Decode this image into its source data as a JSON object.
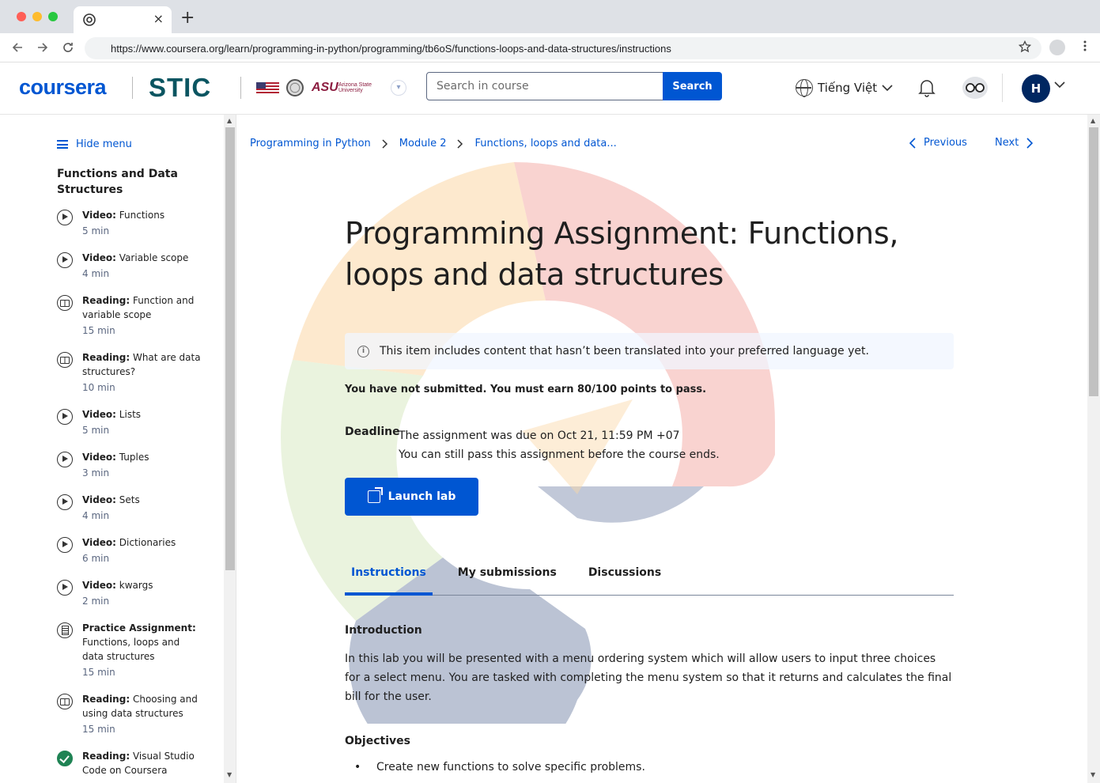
{
  "browser": {
    "tab_close": "×",
    "new_tab": "+",
    "url": "https://www.coursera.org/learn/programming-in-python/programming/tb6oS/functions-loops-and-data-structures/instructions",
    "back_icon": "arrow-left-icon",
    "forward_icon": "arrow-right-icon",
    "reload_icon": "reload-icon"
  },
  "header": {
    "logo_coursera": "coursera",
    "logo_stic": "STIC",
    "asu_logo": "ASU",
    "asu_sub": "Arizona State University",
    "search_placeholder": "Search in course",
    "search_button": "Search",
    "language": "Tiếng Việt",
    "avatar_initial": "H",
    "colors": {
      "brand": "#0056d2",
      "stic": "#0b5561",
      "avatar": "#002761"
    }
  },
  "sidebar": {
    "hide_menu": "Hide menu",
    "title": "Functions and Data Structures",
    "items": [
      {
        "type": "Video:",
        "name": "Functions",
        "duration": "5 min",
        "icon": "play"
      },
      {
        "type": "Video:",
        "name": "Variable scope",
        "duration": "4 min",
        "icon": "play"
      },
      {
        "type": "Reading:",
        "name": "Function and variable scope",
        "duration": "15 min",
        "icon": "book"
      },
      {
        "type": "Reading:",
        "name": "What are data structures?",
        "duration": "10 min",
        "icon": "book"
      },
      {
        "type": "Video:",
        "name": "Lists",
        "duration": "5 min",
        "icon": "play"
      },
      {
        "type": "Video:",
        "name": "Tuples",
        "duration": "3 min",
        "icon": "play"
      },
      {
        "type": "Video:",
        "name": "Sets",
        "duration": "4 min",
        "icon": "play"
      },
      {
        "type": "Video:",
        "name": "Dictionaries",
        "duration": "6 min",
        "icon": "play"
      },
      {
        "type": "Video:",
        "name": "kwargs",
        "duration": "2 min",
        "icon": "play"
      },
      {
        "type": "Practice Assignment:",
        "name": "Functions, loops and data structures",
        "duration": "15 min",
        "icon": "doc"
      },
      {
        "type": "Reading:",
        "name": "Choosing and using data structures",
        "duration": "15 min",
        "icon": "book"
      },
      {
        "type": "Reading:",
        "name": "Visual Studio Code on Coursera",
        "duration": "",
        "icon": "done"
      }
    ]
  },
  "breadcrumb": {
    "items": [
      "Programming in Python",
      "Module 2",
      "Functions, loops and data..."
    ],
    "separator": ">"
  },
  "nav": {
    "previous": "Previous",
    "next": "Next"
  },
  "main": {
    "title": "Programming Assignment: Functions, loops and data structures",
    "notice": "This item includes content that hasn’t been translated into your preferred language yet.",
    "status": "You have not submitted. You must earn 80/100 points to pass.",
    "deadline_label": "Deadline",
    "deadline_line1": "The assignment was due on Oct 21, 11:59 PM +07",
    "deadline_line2": "You can still pass this assignment before the course ends.",
    "launch_button": "Launch lab",
    "tabs": [
      "Instructions",
      "My submissions",
      "Discussions"
    ],
    "intro_heading": "Introduction",
    "intro_text": "In this lab you will be presented with a menu ordering system which will allow users to input three choices for a select menu. You are tasked with completing the menu system so that it returns and calculates the final bill for the user.",
    "objectives_heading": "Objectives",
    "objective_1": "Create new functions to solve specific problems."
  }
}
